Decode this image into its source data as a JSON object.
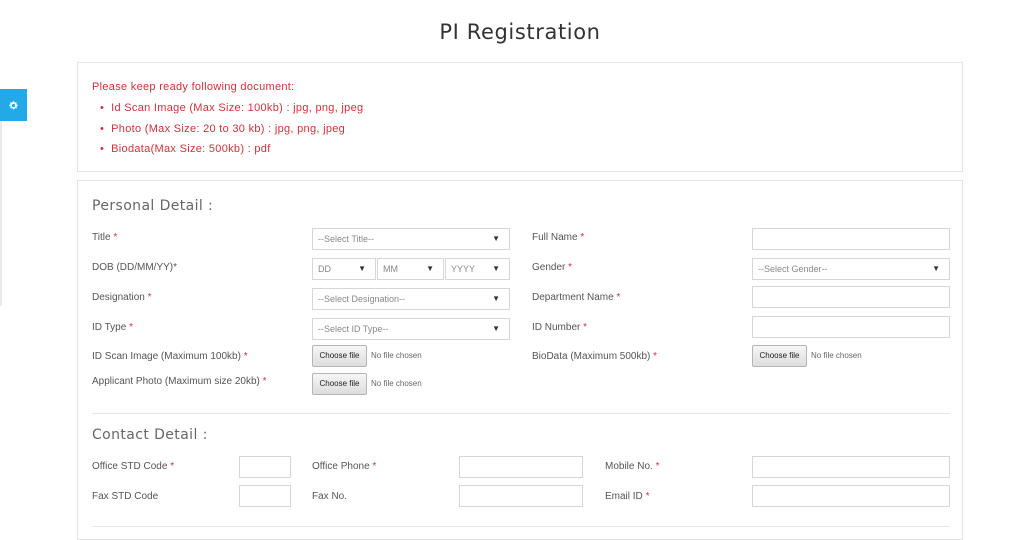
{
  "page": {
    "title": "PI Registration"
  },
  "notice": {
    "heading": "Please keep ready following document:",
    "items": [
      "Id Scan Image (Max Size: 100kb) : jpg, png, jpeg",
      "Photo (Max Size: 20 to 30 kb) : jpg, png, jpeg",
      "Biodata(Max Size: 500kb) : pdf"
    ],
    "color": "#d0323a"
  },
  "accent_color": "#23a8e8",
  "personal": {
    "heading": "Personal Detail :",
    "title_label": "Title",
    "title_select": "--Select Title--",
    "fullname_label": "Full Name",
    "dob_label": "DOB (DD/MM/YY)*",
    "dob_day": "DD",
    "dob_month": "MM",
    "dob_year": "YYYY",
    "gender_label": "Gender",
    "gender_select": "--Select Gender--",
    "designation_label": "Designation",
    "designation_select": "--Select Designation--",
    "department_label": "Department Name",
    "idtype_label": "ID Type",
    "idtype_select": "--Select ID Type--",
    "idnumber_label": "ID Number",
    "idscan_label": "ID Scan Image (Maximum 100kb)",
    "biodata_label": "BioData (Maximum 500kb)",
    "photo_label": "Applicant Photo (Maximum size 20kb)",
    "choose_file": "Choose file",
    "no_file": "No file chosen",
    "required_mark": "*"
  },
  "contact": {
    "heading": "Contact Detail :",
    "office_std_label": "Office STD Code",
    "office_phone_label": "Office Phone",
    "mobile_label": "Mobile No.",
    "fax_std_label": "Fax STD Code",
    "fax_no_label": "Fax No.",
    "email_label": "Email ID"
  }
}
